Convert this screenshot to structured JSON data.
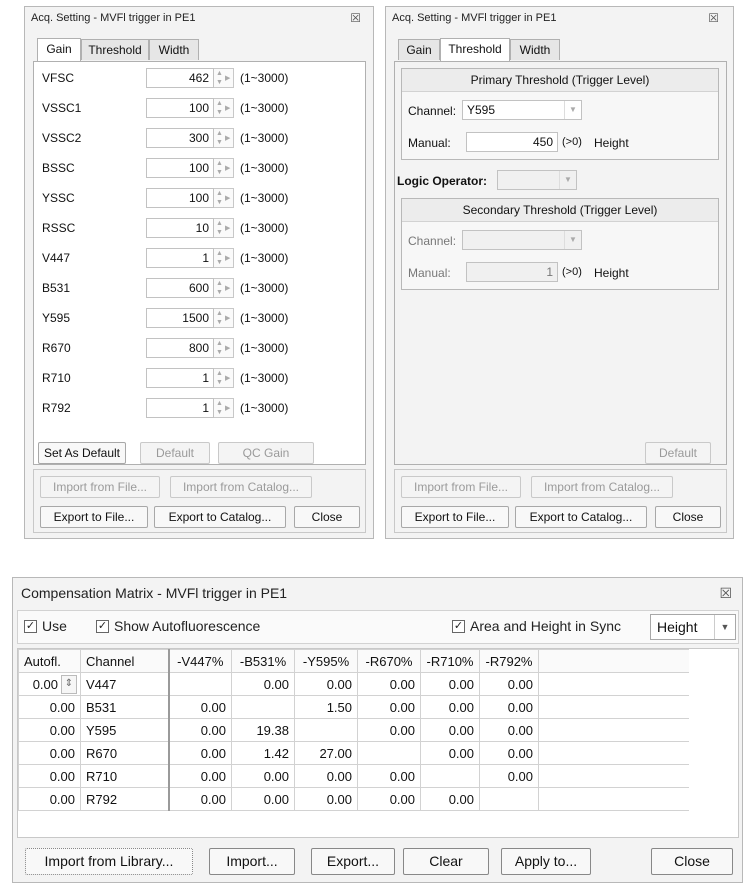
{
  "gain_dialog": {
    "title": "Acq. Setting - MVFl trigger in PE1",
    "close_glyph": "☒",
    "tabs": [
      "Gain",
      "Threshold",
      "Width"
    ],
    "rows": [
      {
        "label": "VFSC",
        "value": "462",
        "range": "(1~3000)"
      },
      {
        "label": "VSSC1",
        "value": "100",
        "range": "(1~3000)"
      },
      {
        "label": "VSSC2",
        "value": "300",
        "range": "(1~3000)"
      },
      {
        "label": "BSSC",
        "value": "100",
        "range": "(1~3000)"
      },
      {
        "label": "YSSC",
        "value": "100",
        "range": "(1~3000)"
      },
      {
        "label": "RSSC",
        "value": "10",
        "range": "(1~3000)"
      },
      {
        "label": "V447",
        "value": "1",
        "range": "(1~3000)"
      },
      {
        "label": "B531",
        "value": "600",
        "range": "(1~3000)"
      },
      {
        "label": "Y595",
        "value": "1500",
        "range": "(1~3000)"
      },
      {
        "label": "R670",
        "value": "800",
        "range": "(1~3000)"
      },
      {
        "label": "R710",
        "value": "1",
        "range": "(1~3000)"
      },
      {
        "label": "R792",
        "value": "1",
        "range": "(1~3000)"
      }
    ],
    "set_as_default": "Set As Default",
    "default": "Default",
    "qc_gain": "QC Gain",
    "import_from_file": "Import from File...",
    "import_from_catalog": "Import from Catalog...",
    "export_to_file": "Export to File...",
    "export_to_catalog": "Export to Catalog...",
    "close": "Close"
  },
  "threshold_dialog": {
    "title": "Acq. Setting - MVFl trigger in PE1",
    "close_glyph": "☒",
    "tabs": [
      "Gain",
      "Threshold",
      "Width"
    ],
    "primary": {
      "title": "Primary Threshold (Trigger Level)",
      "channel_label": "Channel:",
      "channel_value": "Y595",
      "manual_label": "Manual:",
      "manual_value": "450",
      "manual_hint": "(>0)",
      "manual_unit": "Height"
    },
    "logic_operator_label": "Logic Operator:",
    "logic_operator_value": "",
    "secondary": {
      "title": "Secondary Threshold (Trigger Level)",
      "channel_label": "Channel:",
      "channel_value": "",
      "manual_label": "Manual:",
      "manual_value": "1",
      "manual_hint": "(>0)",
      "manual_unit": "Height"
    },
    "default": "Default",
    "import_from_file": "Import from File...",
    "import_from_catalog": "Import from Catalog...",
    "export_to_file": "Export to File...",
    "export_to_catalog": "Export to Catalog...",
    "close": "Close"
  },
  "comp_matrix": {
    "title": "Compensation Matrix - MVFl trigger in PE1",
    "close_glyph": "☒",
    "use_label": "Use",
    "use_checked": true,
    "show_af_label": "Show Autofluorescence",
    "show_af_checked": true,
    "sync_label": "Area and Height in Sync",
    "sync_checked": true,
    "mode_value": "Height",
    "columns": [
      "Autofl.",
      "Channel",
      "-V447%",
      "-B531%",
      "-Y595%",
      "-R670%",
      "-R710%",
      "-R792%"
    ],
    "rows": [
      [
        "0.00",
        "V447",
        "",
        "0.00",
        "0.00",
        "0.00",
        "0.00",
        "0.00"
      ],
      [
        "0.00",
        "B531",
        "0.00",
        "",
        "1.50",
        "0.00",
        "0.00",
        "0.00"
      ],
      [
        "0.00",
        "Y595",
        "0.00",
        "19.38",
        "",
        "0.00",
        "0.00",
        "0.00"
      ],
      [
        "0.00",
        "R670",
        "0.00",
        "1.42",
        "27.00",
        "",
        "0.00",
        "0.00"
      ],
      [
        "0.00",
        "R710",
        "0.00",
        "0.00",
        "0.00",
        "0.00",
        "",
        "0.00"
      ],
      [
        "0.00",
        "R792",
        "0.00",
        "0.00",
        "0.00",
        "0.00",
        "0.00",
        ""
      ]
    ],
    "import_from_library": "Import from Library...",
    "import": "Import...",
    "export": "Export...",
    "clear": "Clear",
    "apply_to": "Apply to...",
    "close": "Close"
  }
}
